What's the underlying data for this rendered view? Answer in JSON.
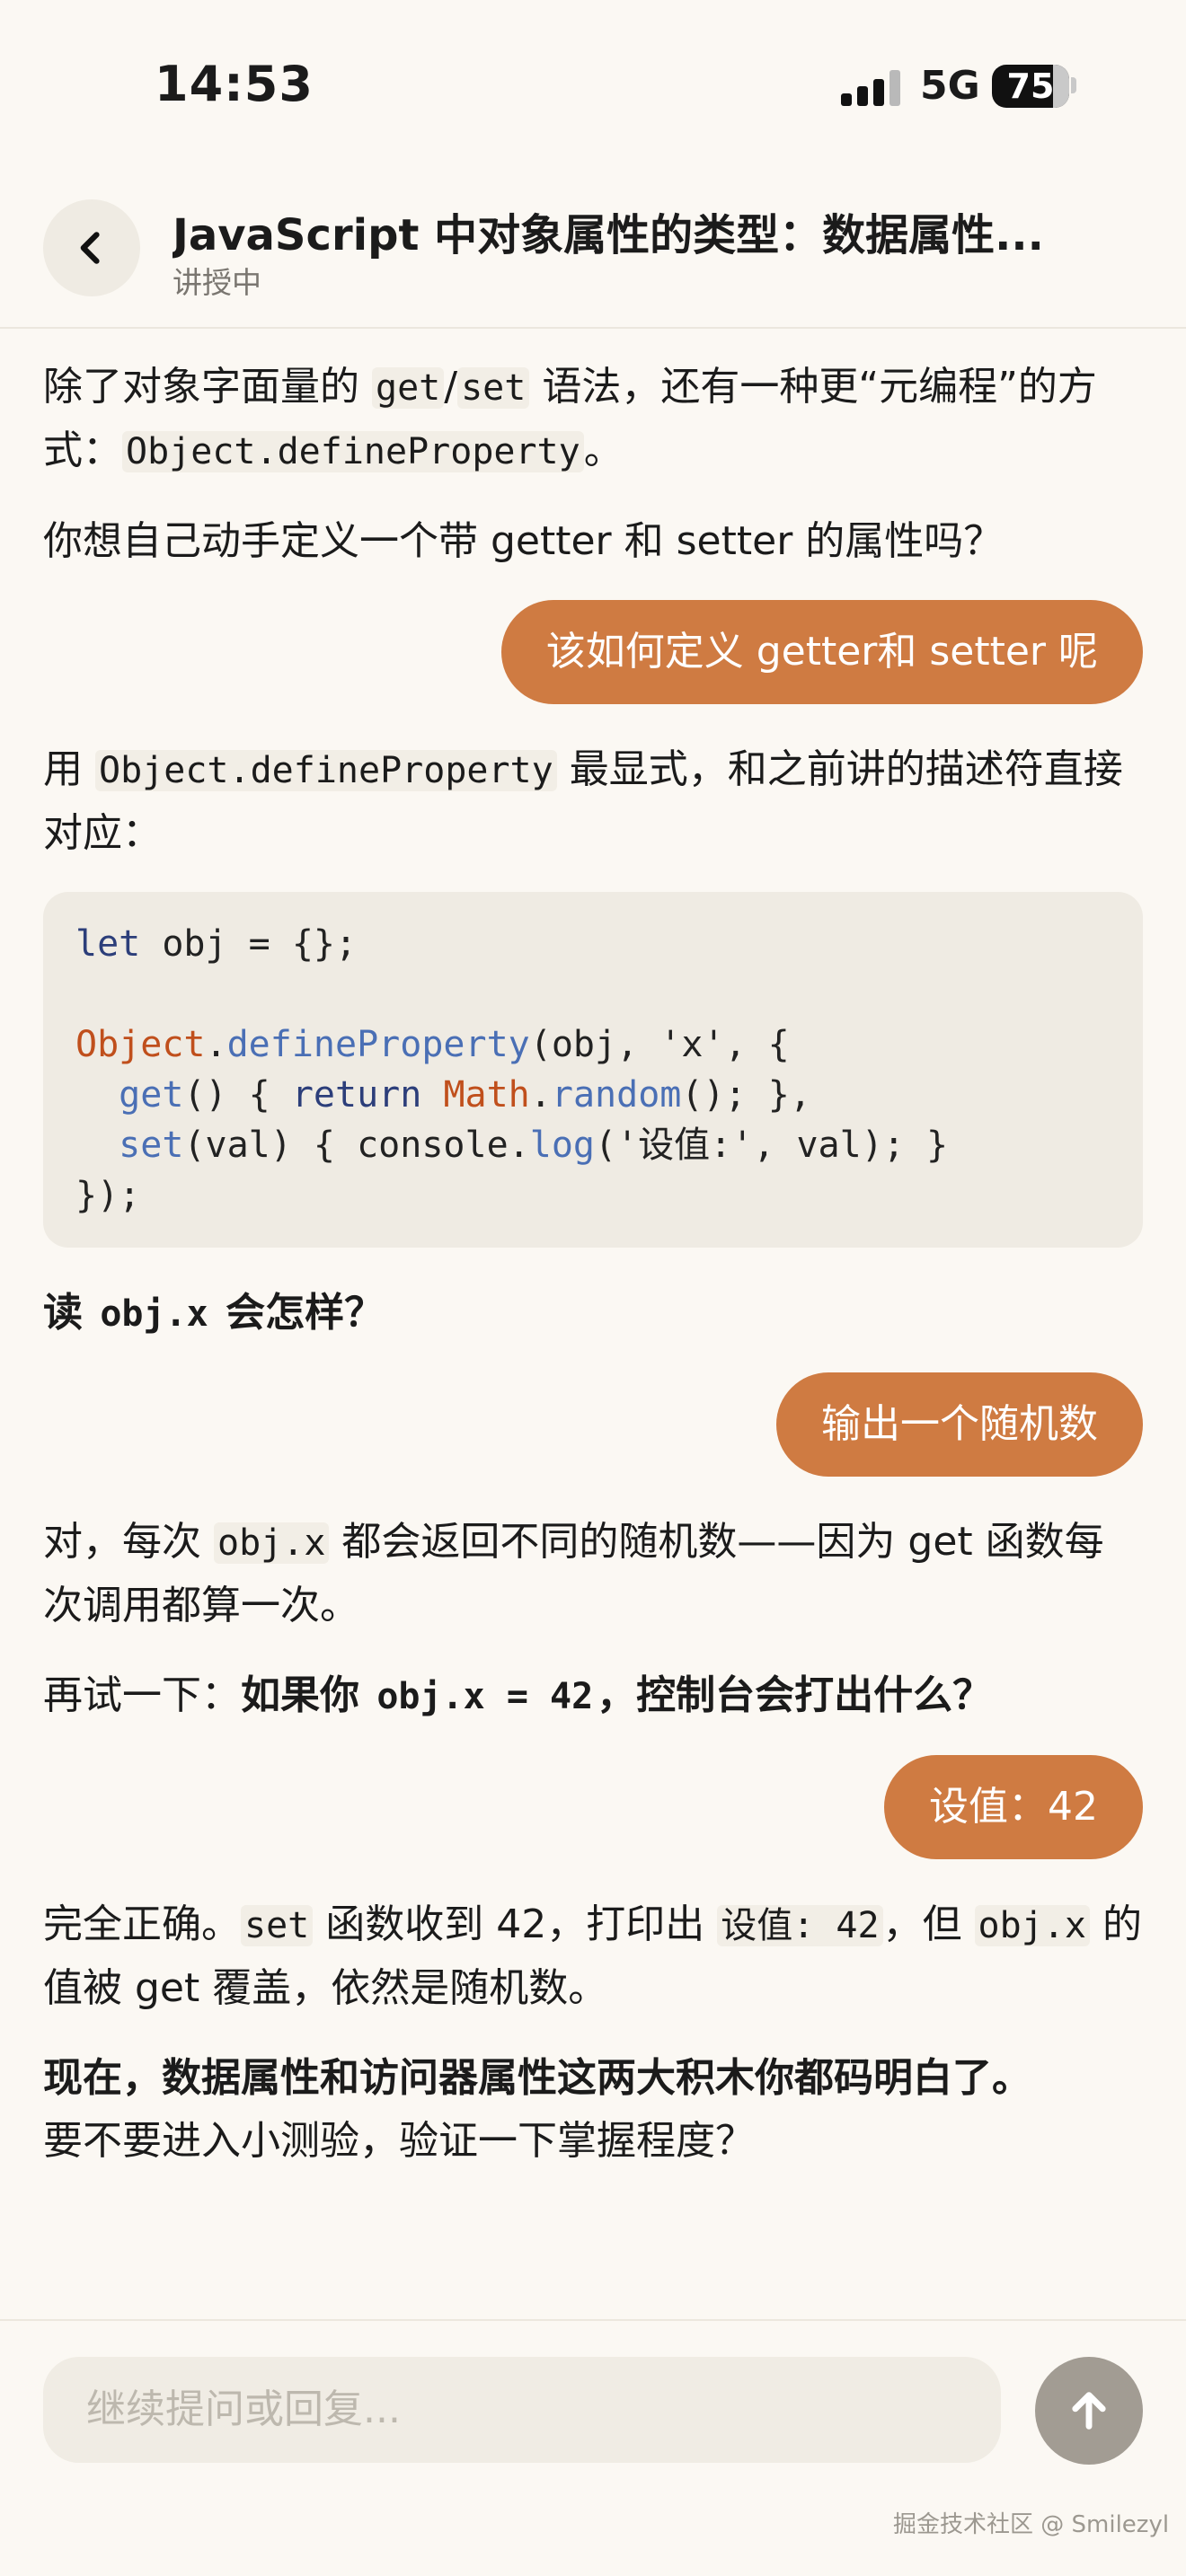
{
  "status_bar": {
    "time": "14:53",
    "network": "5G",
    "battery": "75"
  },
  "header": {
    "title": "JavaScript 中对象属性的类型：数据属性...",
    "subtitle": "讲授中"
  },
  "messages": {
    "m1": {
      "a": "除了对象字面量的 ",
      "c1": "get",
      "b": "/",
      "c2": "set",
      "c": " 语法，还有一种更“元编程”的方式：",
      "c3": "Object.defineProperty",
      "d": "。"
    },
    "m2": "你想自己动手定义一个带 getter 和 setter 的属性吗？",
    "u1": "该如何定义 getter和 setter 呢",
    "m3": {
      "a": "用 ",
      "c1": "Object.defineProperty",
      "b": " 最显式，和之前讲的描述符直接对应："
    },
    "code": {
      "l1_kw": "let",
      "l1_rest": " obj = {};",
      "l3_cls": "Object",
      "l3_dot": ".",
      "l3_fn": "defineProperty",
      "l3_rest": "(obj, 'x', {",
      "l4_fn": "get",
      "l4_a": "() { ",
      "l4_kw": "return",
      "l4_sp": " ",
      "l4_cls": "Math",
      "l4_dot": ".",
      "l4_fn2": "random",
      "l4_rest": "(); },",
      "l5_fn": "set",
      "l5_a": "(val) { console.",
      "l5_fn2": "log",
      "l5_rest": "('设值:', val); }",
      "l6": "});"
    },
    "m4": {
      "a": "读 ",
      "c1": "obj.x",
      "b": " 会怎样？"
    },
    "u2": "输出一个随机数",
    "m5": {
      "a": "对，每次 ",
      "c1": "obj.x",
      "b": " 都会返回不同的随机数——因为 get 函数每次调用都算一次。"
    },
    "m6": {
      "a": "再试一下：",
      "b": "如果你 ",
      "c1": "obj.x = 42",
      "c": "，控制台会打出什么？"
    },
    "u3": "设值：42",
    "m7": {
      "a": "完全正确。",
      "c1": "set",
      "b": " 函数收到 42，打印出 ",
      "c2": "设值: 42",
      "c": "，但 ",
      "c3": "obj.x",
      "d": " 的值被 get 覆盖，依然是随机数。"
    },
    "m8": {
      "a": "现在，数据属性和访问器属性这两大积木你都码明白了。",
      "b": "要不要进入小测验，验证一下掌握程度？"
    }
  },
  "input": {
    "placeholder": "继续提问或回复..."
  },
  "watermark": "掘金技术社区 @ Smilezyl",
  "colors": {
    "accent": "#cf7b42",
    "background": "#fbf8f3",
    "code_bg": "#efebe3"
  },
  "icons": {
    "back": "chevron-left-icon",
    "send": "arrow-up-icon"
  }
}
